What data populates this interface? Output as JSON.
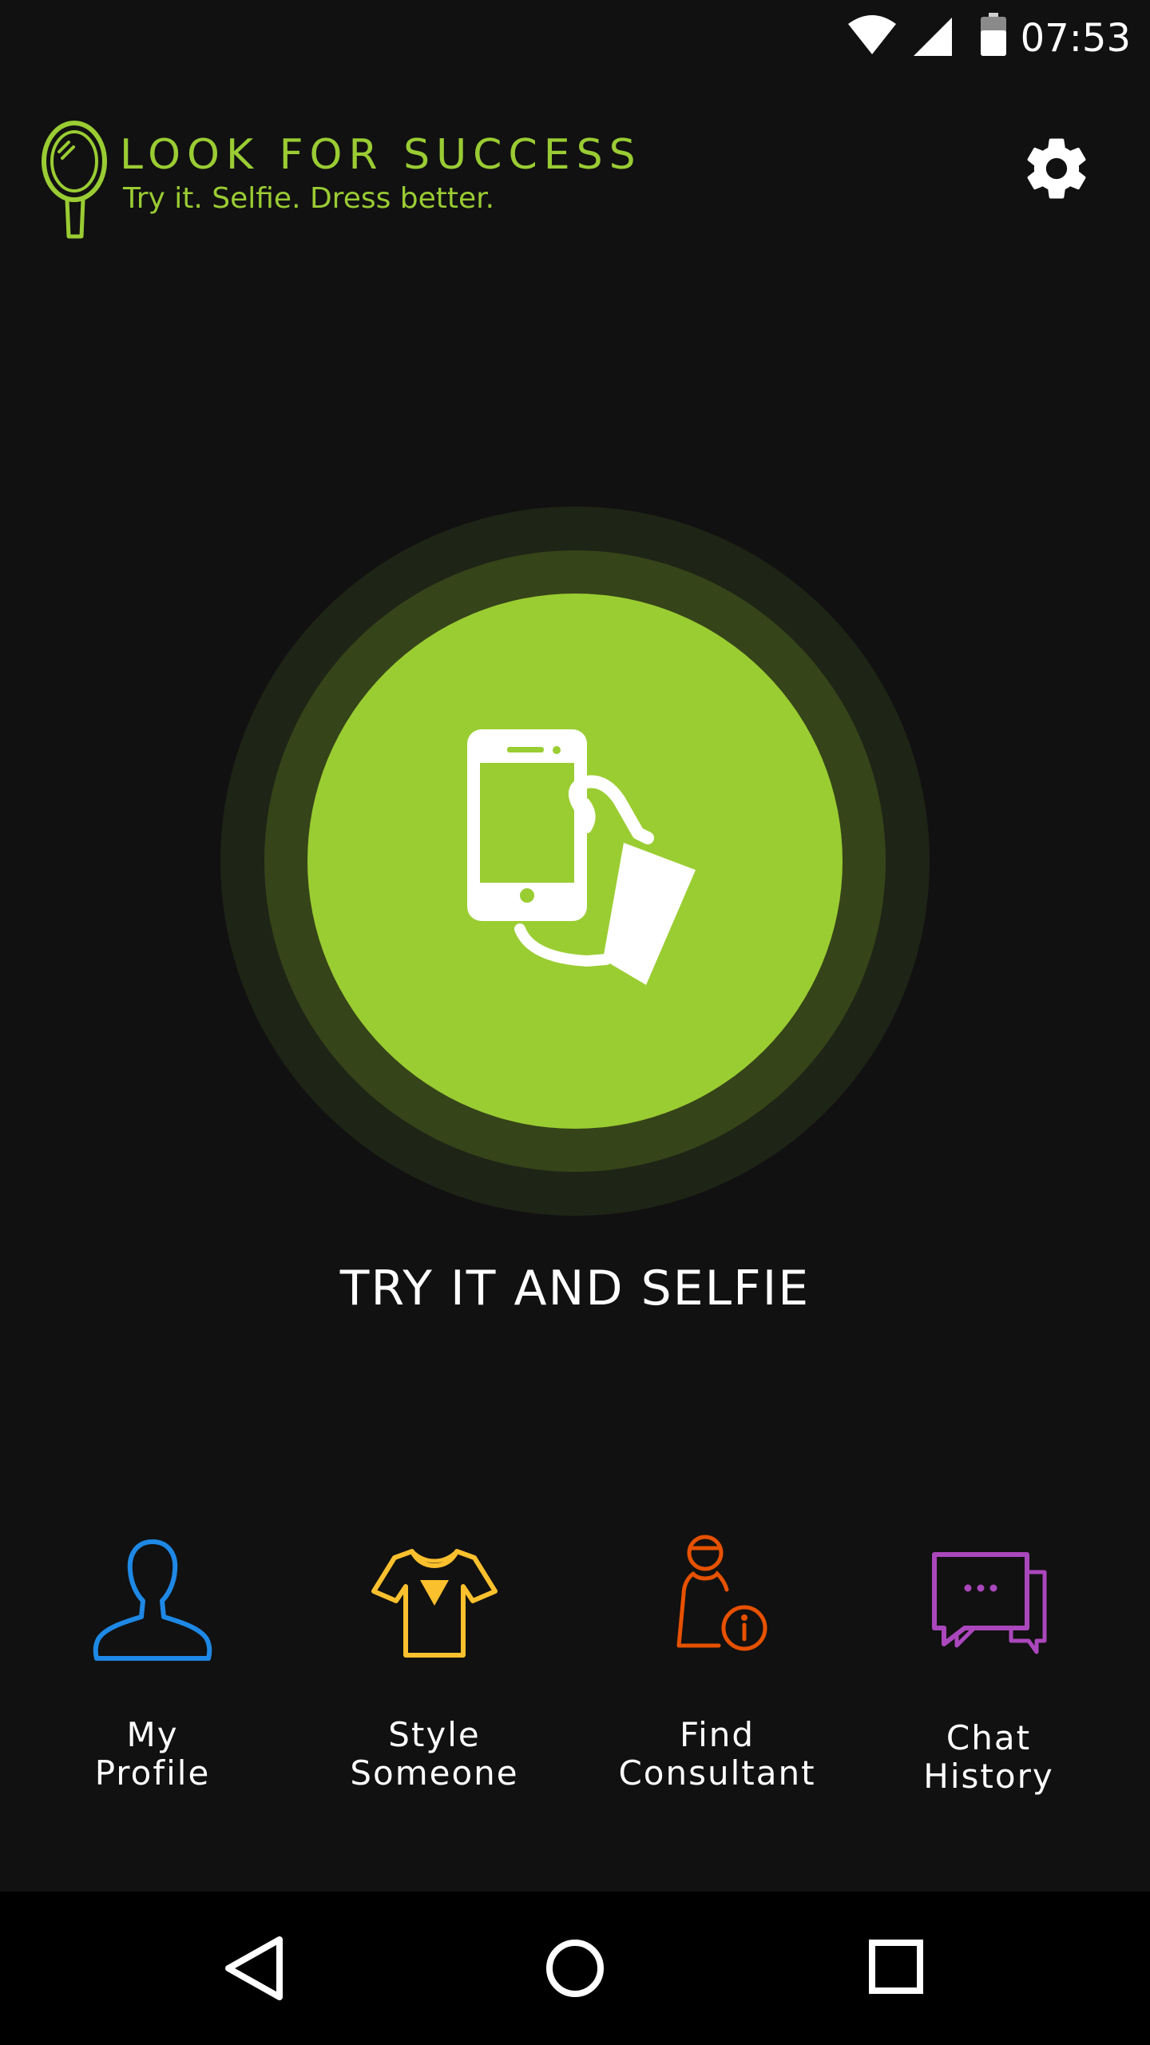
{
  "status_bar": {
    "time": "07:53",
    "icons": [
      "wifi-icon",
      "cell-signal-icon",
      "battery-icon"
    ]
  },
  "header": {
    "brand_title": "LOOK FOR SUCCESS",
    "tagline": "Try it. Selfie. Dress better.",
    "logo_icon": "mirror-icon",
    "settings_icon": "gear-icon"
  },
  "hero": {
    "icon": "hand-holding-phone-icon",
    "label": "TRY IT AND SELFIE"
  },
  "menu": {
    "items": [
      {
        "label": "My\nProfile",
        "icon": "person-outline-icon",
        "color": "#1e88e5"
      },
      {
        "label": "Style\nSomeone",
        "icon": "t-shirt-icon",
        "color": "#fbc02d"
      },
      {
        "label": "Find\nConsultant",
        "icon": "consultant-info-icon",
        "color": "#e65100"
      },
      {
        "label": "Chat\nHistory",
        "icon": "chat-bubbles-icon",
        "color": "#ab47bc"
      }
    ]
  },
  "nav_bar": {
    "buttons": [
      "back-icon",
      "home-icon",
      "recents-icon"
    ]
  },
  "colors": {
    "background": "#111111",
    "accent": "#9acd32",
    "ring_outer": "#1e2416",
    "ring_inner": "#364419",
    "nav_bar": "#000000"
  }
}
